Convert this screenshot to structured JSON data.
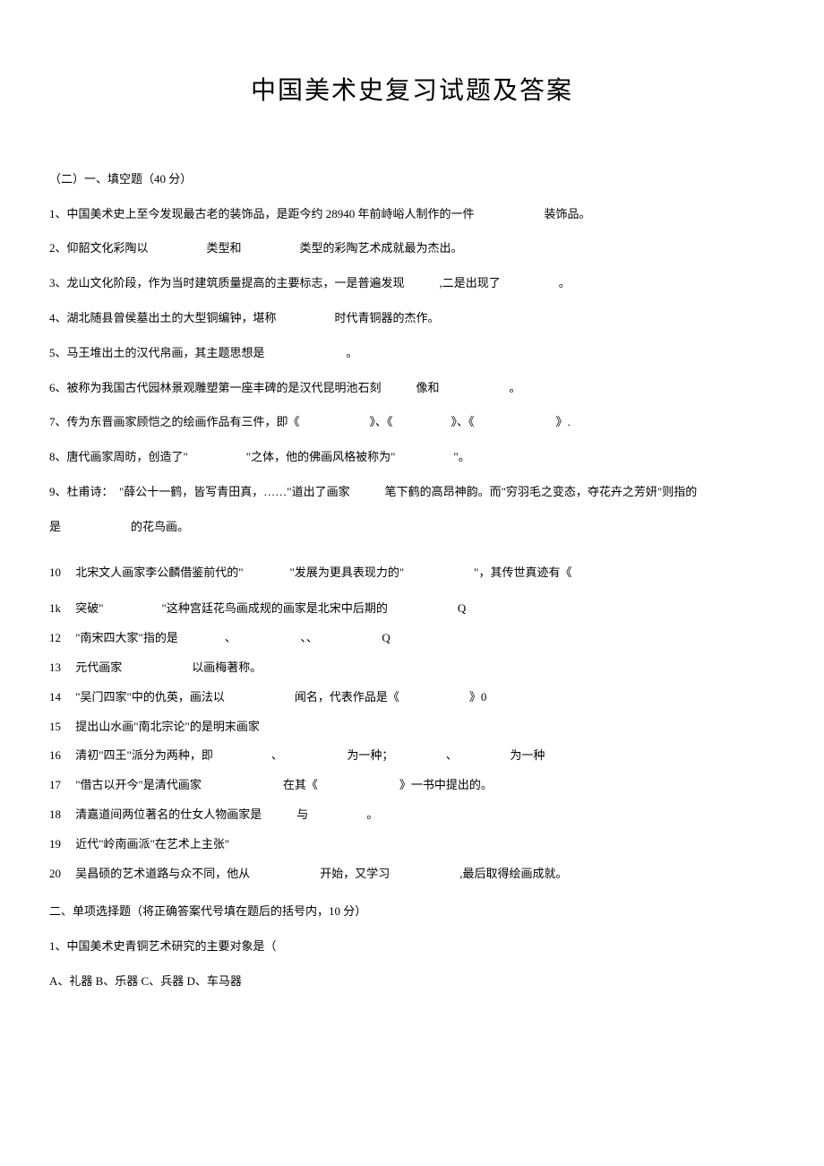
{
  "title": "中国美术史复习试题及答案",
  "section1": {
    "header": "（二）一、填空题（40 分）",
    "q1": "1、中国美术史上至今发现最古老的装饰品，是距今约 28940 年前峙峪人制作的一件　　　　　　装饰品。",
    "q2": "2、仰韶文化彩陶以　　　　　类型和　　　　　类型的彩陶艺术成就最为杰出。",
    "q3": "3、龙山文化阶段，作为当时建筑质量提高的主要标志，一是普遍发现　　　,二是出现了　　　　　。",
    "q4": "4、湖北随县曾侯墓出土的大型铜编钟，堪称　　　　　时代青铜器的杰作。",
    "q5": "5、马王堆出土的汉代帛画，其主题思想是　　　　　　　。",
    "q6": "6、被称为我国古代园林景观雕塑第一座丰碑的是汉代昆明池石刻　　　像和　　　　　　。",
    "q7": "7、传为东晋画家顾恺之的绘画作品有三件，即《　　　　　　》、《　　　　　》、《　　　　　　　》.",
    "q8": "8、唐代画家周昉，创造了\"　　　　　\"之体，他的佛画风格被称为\"　　　　　\"。",
    "q9": "9、杜甫诗：　\"薛公十一鹤，皆写青田真，……\"道出了画家　　　笔下鹤的高昂神韵。而\"穷羽毛之变态，夺花卉之芳妍\"则指的",
    "q9b": "是　　　　　　的花鸟画。"
  },
  "list": {
    "n10": "10",
    "q10": "北宋文人画家李公麟借鉴前代的\"　　　　\"发展为更具表现力的\"　　　　　　\"，其传世真迹有《",
    "n11": "1k",
    "q11": "突破\"　　　　　\"这种宫廷花鸟画成规的画家是北宋中后期的　　　　　　Q",
    "n12": "12",
    "q12": "\"南宋四大家\"指的是　　　　、　　　　　　、、　　　　　　Q",
    "n13": "13",
    "q13": "元代画家　　　　　　以画梅著称。",
    "n14": "14",
    "q14": "\"吴门四家\"中的仇英，画法以　　　　　　闻名，代表作品是《　　　　　　》0",
    "n15": "15",
    "q15": "提出山水画\"南北宗论\"的是明末画家",
    "n16": "16",
    "q16": "清初\"四王\"派分为两种，即　　　　　、　　　　　　为一种；　　　　　、　　　　　为一种",
    "n17": "17",
    "q17": "\"借古以开今\"是清代画家　　　　　　　在其《　　　　　　　》一书中提出的。",
    "n18": "18",
    "q18": "清嘉道间两位著名的仕女人物画家是　　　与　　　　　。",
    "n19": "19",
    "q19": "近代\"岭南画派\"在艺术上主张\"",
    "n20": "20",
    "q20": "吴昌硕的艺术道路与众不同，他从　　　　　　开始，又学习　　　　　　,最后取得绘画成就。"
  },
  "section2": {
    "header": "二、单项选择题（将正确答案代号填在题后的括号内，10 分）",
    "q1": "1、中国美术史青铜艺术研究的主要对象是（",
    "q1opts": "A、礼器 B、乐器 C、兵器 D、车马器"
  }
}
